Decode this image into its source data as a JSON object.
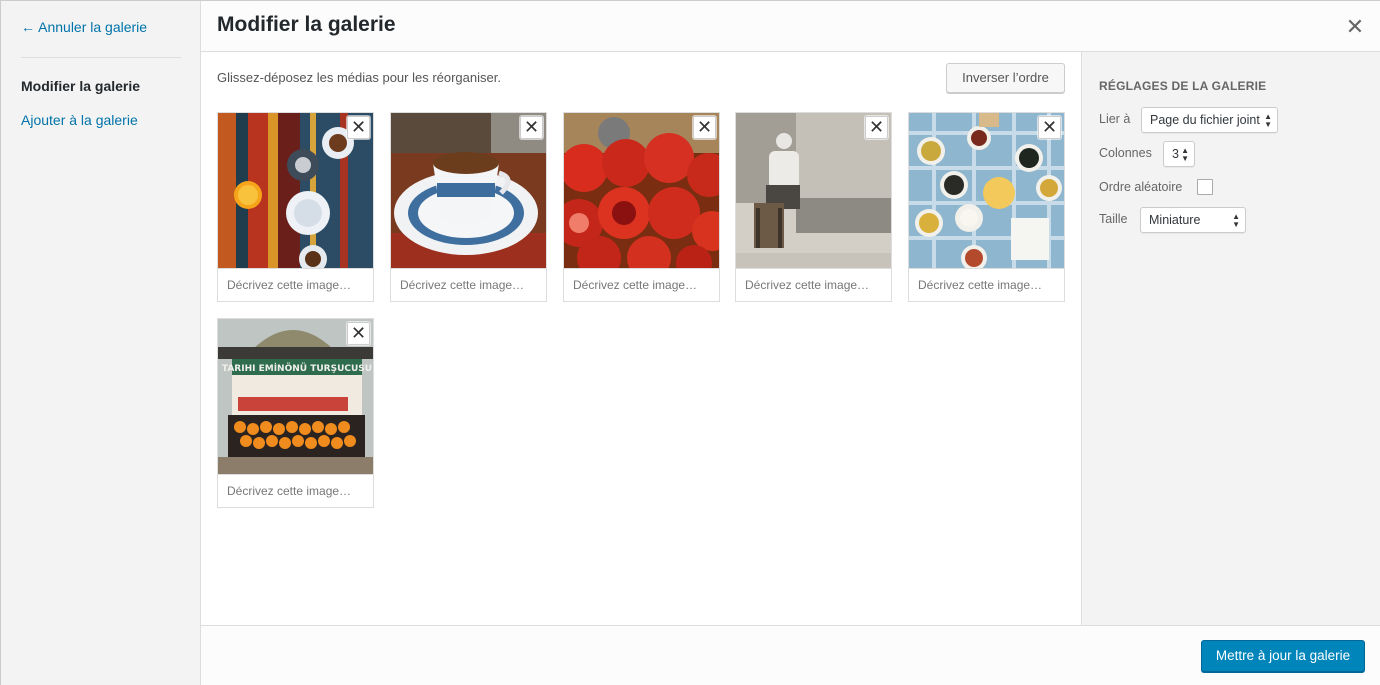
{
  "menu": {
    "cancel_label": "← Annuler la galerie",
    "active_label": "Modifier la galerie",
    "add_label": "Ajouter à la galerie"
  },
  "header": {
    "title": "Modifier la galerie",
    "close_label": "✕"
  },
  "content": {
    "instructions": "Glissez-déposez les médias pour les réorganiser.",
    "reverse_label": "Inverser l’ordre",
    "attachments": [
      {
        "caption_placeholder": "Décrivez cette image…",
        "remove_label": "✕",
        "icon": "rug-coffee-table-image"
      },
      {
        "caption_placeholder": "Décrivez cette image…",
        "remove_label": "✕",
        "icon": "turkish-coffee-cup-image"
      },
      {
        "caption_placeholder": "Décrivez cette image…",
        "remove_label": "✕",
        "icon": "pomegranates-image"
      },
      {
        "caption_placeholder": "Décrivez cette image…",
        "remove_label": "✕",
        "icon": "old-man-sitting-image"
      },
      {
        "caption_placeholder": "Décrivez cette image…",
        "remove_label": "✕",
        "icon": "breakfast-table-image"
      },
      {
        "caption_placeholder": "Décrivez cette image…",
        "remove_label": "✕",
        "icon": "pickle-stand-image"
      }
    ],
    "stand_sign": "TARIHI EMİNÖNÜ TURŞUCUSU"
  },
  "settings": {
    "heading": "Réglages de la galerie",
    "link_label": "Lier à",
    "link_value": "Page du fichier joint",
    "columns_label": "Colonnes",
    "columns_value": "3",
    "random_label": "Ordre aléatoire",
    "random_checked": false,
    "size_label": "Taille",
    "size_value": "Miniature"
  },
  "footer": {
    "update_label": "Mettre à jour la galerie"
  },
  "colors": {
    "primary": "#0085ba",
    "link": "#0073aa",
    "sidebar_bg": "#f3f3f3"
  }
}
